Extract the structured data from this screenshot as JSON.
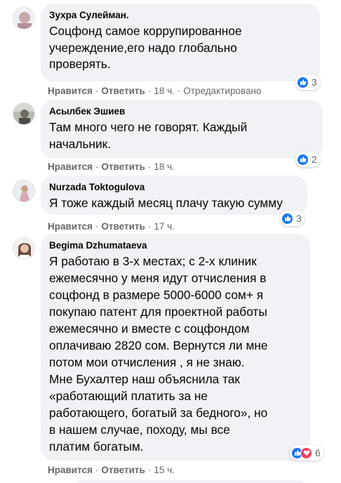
{
  "comments": [
    {
      "author": "Зухра Сулейман.",
      "lines": [
        "Соцфонд самое коррупированное",
        "учереждение,его надо глобально",
        "проверять."
      ],
      "reactions": {
        "count": "3",
        "types": [
          "like-icon"
        ]
      },
      "like": "Нравится",
      "reply": "Ответить",
      "time": "18 ч.",
      "edited": "Отредактировано",
      "avatar_color": "#c9a6a8"
    },
    {
      "author": "Асылбек Эшиев",
      "lines": [
        "Там много чего не говорят. Каждый",
        "начальник."
      ],
      "reactions": {
        "count": "2",
        "types": [
          "like-icon"
        ]
      },
      "like": "Нравится",
      "reply": "Ответить",
      "time": "18 ч.",
      "avatar_color": "#8a8f86"
    },
    {
      "author": "Nurzada Toktogulova",
      "lines": [
        "Я тоже каждый месяц плачу такую сумму"
      ],
      "reactions": {
        "count": "3",
        "types": [
          "like-icon"
        ]
      },
      "like": "Нравится",
      "reply": "Ответить",
      "time": "17 ч.",
      "avatar_color": "#d8a8b6"
    },
    {
      "author": "Begima Dzhumataeva",
      "lines": [
        "Я работаю в 3-х местах; с 2-х клиник",
        "ежемесячно у меня идут отчисления в",
        "соцфонд в размере 5000-6000 сом+ я",
        "покупаю патент для проектной работы",
        "ежемесячно и вместе с соцфондом",
        "оплачиваю 2820 сом. Вернутся ли мне",
        "потом мои отчисления , я не знаю.",
        "Мне Бухалтер наш объяснила так",
        "«работающий платить за не",
        "работающего, богатый за бедного», но",
        "в нашем случае, походу, мы все",
        "платим богатым."
      ],
      "reactions": {
        "count": "6",
        "types": [
          "like-icon",
          "love-icon"
        ]
      },
      "like": "Нравится",
      "reply": "Ответить",
      "time": "15 ч.",
      "avatar_color": "#e6d3cf"
    }
  ]
}
